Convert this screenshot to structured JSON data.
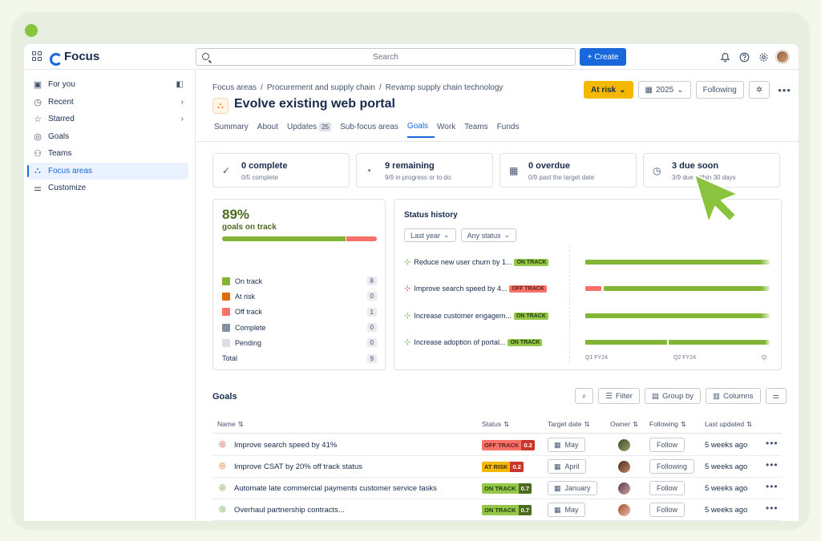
{
  "topbar": {
    "app_name": "Focus",
    "search_placeholder": "Search",
    "create_label": "Create"
  },
  "sidebar": {
    "items": [
      {
        "label": "For you",
        "icon": "for-you-icon"
      },
      {
        "label": "Recent",
        "icon": "clock-icon"
      },
      {
        "label": "Starred",
        "icon": "star-icon"
      },
      {
        "label": "Goals",
        "icon": "target-icon"
      },
      {
        "label": "Teams",
        "icon": "people-icon"
      },
      {
        "label": "Focus areas",
        "icon": "hierarchy-icon"
      },
      {
        "label": "Customize",
        "icon": "sliders-icon"
      }
    ]
  },
  "header": {
    "breadcrumb": [
      "Focus areas",
      "Procurement and supply chain",
      "Revamp supply chain technology"
    ],
    "title": "Evolve existing web portal",
    "status_button": "At risk",
    "year_button": "2025",
    "following_button": "Following"
  },
  "tabs": [
    {
      "label": "Summary"
    },
    {
      "label": "About"
    },
    {
      "label": "Updates",
      "badge": "25"
    },
    {
      "label": "Sub-focus areas"
    },
    {
      "label": "Goals"
    },
    {
      "label": "Work"
    },
    {
      "label": "Teams"
    },
    {
      "label": "Funds"
    }
  ],
  "stats": [
    {
      "title": "0 complete",
      "sub": "0/5 complete",
      "icon": "check-circle-icon"
    },
    {
      "title": "9 remaining",
      "sub": "9/9 in progress or to do",
      "icon": "pie-icon"
    },
    {
      "title": "0 overdue",
      "sub": "0/9 past the target date",
      "icon": "calendar-icon"
    },
    {
      "title": "3 due soon",
      "sub": "3/9 due within 30 days",
      "icon": "clock-icon"
    }
  ],
  "summary": {
    "percent": "89%",
    "label": "goals on track",
    "on_track_fraction": 0.8,
    "legend": [
      {
        "label": "On track",
        "count": "8",
        "color": "#82b536"
      },
      {
        "label": "At risk",
        "count": "0",
        "color": "#e06c00"
      },
      {
        "label": "Off track",
        "count": "1",
        "color": "#f87168"
      },
      {
        "label": "Complete",
        "count": "0",
        "color": "#8590a2"
      },
      {
        "label": "Pending",
        "count": "0",
        "color": "#dcdfe4"
      },
      {
        "label": "Total",
        "count": "9",
        "color": ""
      }
    ]
  },
  "history": {
    "title": "Status history",
    "filter_time": "Last year",
    "filter_status": "Any status",
    "rows": [
      {
        "name": "Reduce new user churn by 1...",
        "status": "ON TRACK"
      },
      {
        "name": "Improve search speed by 4...",
        "status": "OFF TRACK"
      },
      {
        "name": "Increase customer engagem...",
        "status": "ON TRACK"
      },
      {
        "name": "Increase adoption of portal...",
        "status": "ON TRACK"
      }
    ],
    "axis": [
      "Q1  FY24",
      "Q2  FY24",
      "Q:"
    ]
  },
  "goals": {
    "title": "Goals",
    "tools": [
      "Filter",
      "Group by",
      "Columns"
    ],
    "columns": [
      "Name",
      "Status",
      "Target date",
      "Owner",
      "Following",
      "Last updated"
    ],
    "rows": [
      {
        "name": "Improve search speed by 41%",
        "status": "OFF TRACK",
        "score": "0.2",
        "date": "May",
        "follow": "Follow",
        "updated": "5 weeks ago"
      },
      {
        "name": "Improve CSAT by 20% off track status",
        "status": "AT RISK",
        "score": "0.2",
        "date": "April",
        "follow": "Following",
        "updated": "5 weeks ago"
      },
      {
        "name": "Automate late commercial payments customer service tasks",
        "status": "ON TRACK",
        "score": "0.7",
        "date": "January",
        "follow": "Follow",
        "updated": "5 weeks ago"
      },
      {
        "name": "Overhaul partnership contracts...",
        "status": "ON TRACK",
        "score": "0.7",
        "date": "May",
        "follow": "Follow",
        "updated": "5 weeks ago"
      }
    ]
  }
}
